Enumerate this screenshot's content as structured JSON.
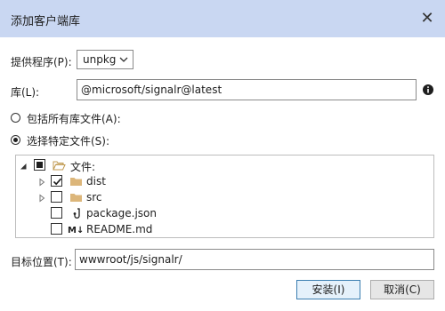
{
  "window": {
    "title": "添加客户端库",
    "close_glyph": "✕"
  },
  "provider": {
    "label": "提供程序(P):",
    "value": "unpkg",
    "chevron_icon": "chevron-down-icon"
  },
  "library": {
    "label": "库(L):",
    "value": "@microsoft/signalr@latest",
    "info_icon": "info-icon"
  },
  "options": [
    {
      "label": "包括所有库文件(A):",
      "checked": false
    },
    {
      "label": "选择特定文件(S):",
      "checked": true
    }
  ],
  "tree": {
    "root": {
      "label": "文件:",
      "state": "partial",
      "expanded": true,
      "icon": "folder-open-icon"
    },
    "items": [
      {
        "label": "dist",
        "checked": true,
        "type": "folder",
        "icon": "folder-icon"
      },
      {
        "label": "src",
        "checked": false,
        "type": "folder",
        "icon": "folder-icon"
      },
      {
        "label": "package.json",
        "checked": false,
        "type": "file",
        "icon": "json-file-icon"
      },
      {
        "label": "README.md",
        "checked": false,
        "type": "file",
        "icon": "markdown-file-icon",
        "icon_text": "M↓"
      }
    ]
  },
  "target": {
    "label": "目标位置(T):",
    "value": "wwwroot/js/signalr/"
  },
  "buttons": {
    "install": "安装(I)",
    "cancel": "取消(C)"
  },
  "colors": {
    "titlebar": "#c9d7f2",
    "folder": "#dcb67a",
    "accent_border": "#3c7fb1"
  }
}
